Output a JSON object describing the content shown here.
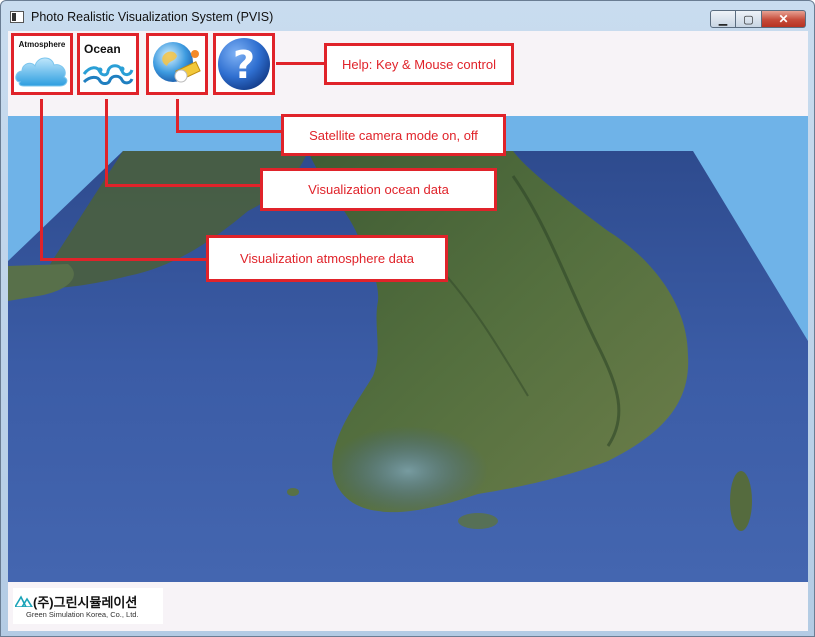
{
  "window": {
    "title": "Photo Realistic Visualization System (PVIS)",
    "minimize_glyph": "▁",
    "maximize_glyph": "▢",
    "close_glyph": "✕"
  },
  "toolbar": {
    "atmosphere_label": "Atmosphere",
    "ocean_label": "Ocean",
    "help_glyph": "?"
  },
  "annotations": {
    "help": "Help: Key & Mouse control",
    "satellite": "Satellite camera mode on, off",
    "ocean": "Visualization ocean data",
    "atmosphere": "Visualization atmosphere data"
  },
  "footer": {
    "company_korean": "(주)그린시뮬레이션",
    "company_english": "Green Simulation Korea, Co., Ltd."
  },
  "colors": {
    "annotation_red": "#e0232a",
    "sky": "#6fb3e8",
    "sea": "#3f5fa3",
    "land": "#4d6a3a"
  }
}
